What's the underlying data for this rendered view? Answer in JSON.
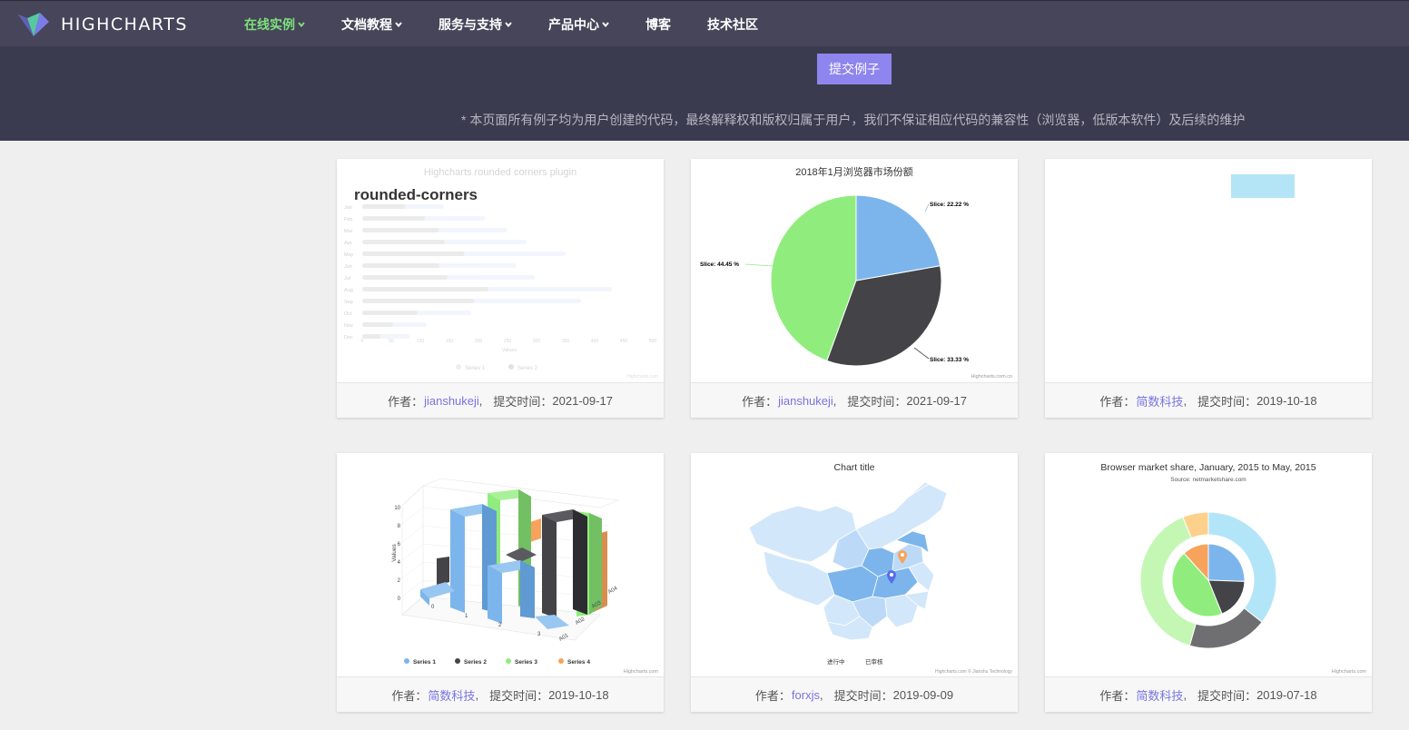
{
  "brand": {
    "name": "HIGHCHARTS",
    "logo": "highcharts-logo"
  },
  "nav": {
    "items": [
      {
        "label": "在线实例",
        "active": true,
        "dropdown": true
      },
      {
        "label": "文档教程",
        "active": false,
        "dropdown": true
      },
      {
        "label": "服务与支持",
        "active": false,
        "dropdown": true
      },
      {
        "label": "产品中心",
        "active": false,
        "dropdown": true
      },
      {
        "label": "博客",
        "active": false,
        "dropdown": false
      },
      {
        "label": "技术社区",
        "active": false,
        "dropdown": false
      }
    ]
  },
  "banner": {
    "submit_label": "提交例子",
    "disclaimer": "* 本页面所有例子均为用户创建的代码，最终解释权和版权归属于用户，我们不保证相应代码的兼容性（浏览器，低版本软件）及后续的维护"
  },
  "colors": {
    "accent": "#8f85ee",
    "active_nav": "#7ee07b",
    "nav_bg": "#464559",
    "banner_bg": "#3b3b4f",
    "author_link": "#7a74e0"
  },
  "cards": [
    {
      "author_prefix": "作者：",
      "author": "jianshukeji",
      "time_prefix": "提交时间：",
      "time": "2021-09-17",
      "thumb": {
        "overlay_title": "rounded-corners",
        "chart_title": "Highcharts rounded corners plugin",
        "months": [
          "Jan",
          "Feb",
          "Mar",
          "Apr",
          "May",
          "Jun",
          "Jul",
          "Aug",
          "Sep",
          "Oct",
          "Nov",
          "Dec"
        ],
        "x_ticks": [
          "0",
          "50",
          "100",
          "150",
          "200",
          "250",
          "300",
          "350",
          "400",
          "450",
          "500"
        ],
        "xlabel": "Values",
        "legend": [
          "Series 1",
          "Series 2"
        ],
        "credits": "Highcharts.com"
      }
    },
    {
      "author_prefix": "作者：",
      "author": "jianshukeji",
      "time_prefix": "提交时间：",
      "time": "2021-09-17",
      "thumb": {
        "chart_title": "2018年1月浏览器市场份额",
        "slices": [
          {
            "label": "Slice: 22.22 %",
            "value": 22.22,
            "color": "#7cb5ec"
          },
          {
            "label": "Slice: 33.33 %",
            "value": 33.33,
            "color": "#434348"
          },
          {
            "label": "Slice: 44.45 %",
            "value": 44.45,
            "color": "#90ed7d"
          }
        ],
        "credits": "Highcharts.com.cn"
      }
    },
    {
      "author_prefix": "作者：",
      "author": "简数科技",
      "time_prefix": "提交时间：",
      "time": "2019-10-18",
      "thumb": {
        "box_color": "#b3e5f6"
      }
    },
    {
      "author_prefix": "作者：",
      "author": "简数科技",
      "time_prefix": "提交时间：",
      "time": "2019-10-18",
      "thumb": {
        "ylabel": "Values",
        "y_ticks": [
          "0",
          "2",
          "4",
          "6",
          "8",
          "10"
        ],
        "x_ticks": [
          "0",
          "1",
          "2",
          "3"
        ],
        "depth_ticks": [
          "A01",
          "A02",
          "A03",
          "A04"
        ],
        "legend": [
          {
            "name": "Series 1",
            "color": "#7cb5ec"
          },
          {
            "name": "Series 2",
            "color": "#434348"
          },
          {
            "name": "Series 3",
            "color": "#90ed7d"
          },
          {
            "name": "Series 4",
            "color": "#f7a35c"
          }
        ],
        "credits": "Highcharts.com"
      }
    },
    {
      "author_prefix": "作者：",
      "author": "forxjs",
      "time_prefix": "提交时间：",
      "time": "2019-09-09",
      "thumb": {
        "chart_title": "Chart title",
        "legend": [
          "进行中",
          "已审核"
        ],
        "credits": "Highcharts.com © Jianshu Technology"
      }
    },
    {
      "author_prefix": "作者：",
      "author": "简数科技",
      "time_prefix": "提交时间：",
      "time": "2019-07-18",
      "thumb": {
        "chart_title": "Browser market share, January, 2015 to May, 2015",
        "subtitle": "Source: netmarketshare.com",
        "credits": "Highcharts.com"
      }
    }
  ]
}
